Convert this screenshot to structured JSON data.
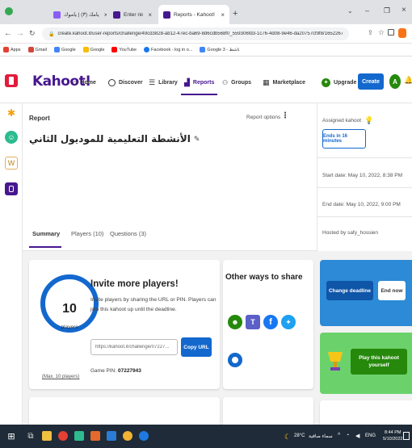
{
  "browser": {
    "tabs": [
      {
        "label": "يامك (٣) | ياموك"
      },
      {
        "label": "Enter nickname - Assignments"
      },
      {
        "label": "Reports - Kahoot!"
      }
    ],
    "url": "create.kahoot.it/user-reports/challenge/49cd3828-ab12-47ec-ba69-8d6cdb568f0_559306fd3-1c76-4d08-9e46-da20757cf9f8/1652267891573/summary",
    "bookmarks": [
      {
        "label": "Apps",
        "color": "#e34133"
      },
      {
        "label": "Gmail",
        "color": "#d44638"
      },
      {
        "label": "Google",
        "color": "#4285f4"
      },
      {
        "label": "Google",
        "color": "#fbbc05"
      },
      {
        "label": "YouTube",
        "color": "#ff0000"
      },
      {
        "label": "Facebook - log in o...",
        "color": "#1877f2"
      },
      {
        "label": "Google ناشط - 3",
        "color": "#4285f4"
      }
    ]
  },
  "kahoot": {
    "logo": "Kahoot!",
    "nav": {
      "home": "Home",
      "discover": "Discover",
      "library": "Library",
      "reports": "Reports",
      "groups": "Groups",
      "marketplace": "Marketplace"
    },
    "upgrade_label": "Upgrade",
    "create_label": "Create",
    "avatar_initial": "A",
    "report": {
      "eyebrow": "Report",
      "title": "الأنشطة التعليمية للموديول الثاني",
      "options_label": "Report options",
      "tabs": {
        "summary": "Summary",
        "players": "Players (10)",
        "questions": "Questions (3)"
      }
    },
    "assigned": {
      "label": "Assigned kahoot",
      "ends_label": "Ends in 16 minutes",
      "start_date": "Start date: May 10, 2022, 8:38 PM",
      "end_date": "End date: May 10, 2022, 9:00 PM",
      "hosted_by": "Hosted by safy_hossien"
    },
    "invite": {
      "players_count": "10",
      "players_label": "players",
      "max_players": "(Max. 10 players)",
      "title": "Invite more players!",
      "description": "Invite players by sharing the URL or PIN. Players can join this kahoot up until the deadline.",
      "url_value": "https://kahoot.it/challenge/07227...",
      "copy_label": "Copy URL",
      "game_pin_label": "Game PIN:",
      "game_pin": "07227943"
    },
    "share": {
      "title": "Other ways to share"
    },
    "deadline": {
      "change_label": "Change deadline",
      "end_now_label": "End now"
    },
    "play": {
      "label": "Play this kahoot yourself"
    }
  },
  "taskbar": {
    "weather": "28°C",
    "weather_text": "سماء صافية",
    "time": "8:44 PM",
    "date": "5/10/2022",
    "lang": "ENG"
  },
  "colors": {
    "kahoot_purple": "#46178f",
    "accent_blue": "#1368ce",
    "progress_blue": "#1368ce",
    "deadline_card": "#2c8ad6",
    "play_card": "#6bd26b",
    "green": "#26890c"
  }
}
